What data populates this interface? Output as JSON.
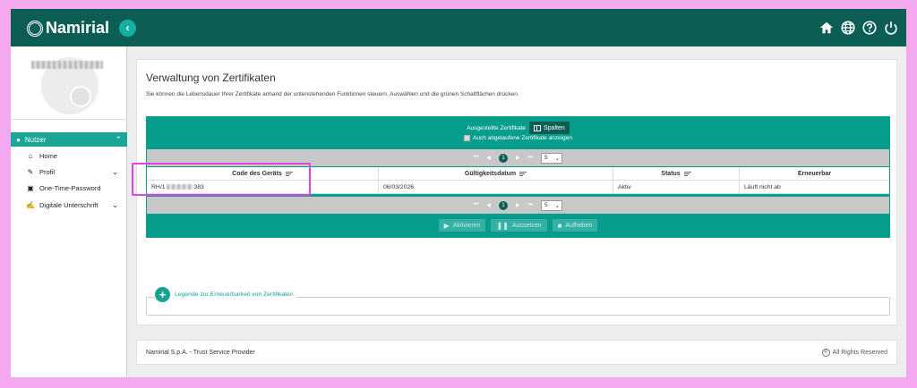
{
  "brand": {
    "name": "Namirial"
  },
  "topbar": {
    "icons": [
      "home-icon",
      "globe-icon",
      "help-icon",
      "power-icon"
    ]
  },
  "sidebar": {
    "section": "Nutzer",
    "items": [
      {
        "label": "Home",
        "icon": "home-icon"
      },
      {
        "label": "Profil",
        "icon": "wrench-icon",
        "expandable": true
      },
      {
        "label": "One-Time-Password",
        "icon": "lock-icon"
      },
      {
        "label": "Digitale Unterschrift",
        "icon": "edit-icon",
        "expandable": true
      }
    ]
  },
  "main": {
    "title": "Verwaltung von Zertifikaten",
    "description": "Sie können die Lebensdauer Ihrer Zertifikate anhand der untenstehenden Funktionen steuern. Auswählen und die grünen Schaltflächen drücken.",
    "table": {
      "caption": "Ausgestellte Zertifikate",
      "columns_button": "Spalten",
      "show_expired_label": "Auch abgelaufene Zertifikate anzeigen",
      "current_page": "1",
      "page_size": "5",
      "headers": [
        "Code des Geräts",
        "Gültigkeitsdatum",
        "Status",
        "Erneuerbar"
      ],
      "rows": [
        {
          "code_prefix": "RH/1",
          "code_suffix": "383",
          "valid_until": "06/03/2026",
          "status": "Aktiv",
          "renewable": "Läuft nicht ab"
        }
      ],
      "actions": [
        {
          "label": "Aktivieren",
          "icon": "play-icon"
        },
        {
          "label": "Aussetzen",
          "icon": "pause-icon"
        },
        {
          "label": "Aufheben",
          "icon": "stop-icon"
        }
      ]
    },
    "legend_link": "Legende zur Erneuerbarkeit von Zertifikaten"
  },
  "footer": {
    "left": "Namirial S.p.A. - Trust Service Provider",
    "right": "All Rights Reserved"
  },
  "colors": {
    "header": "#0c5e55",
    "accent": "#079d8d",
    "highlight": "#e044e0"
  }
}
